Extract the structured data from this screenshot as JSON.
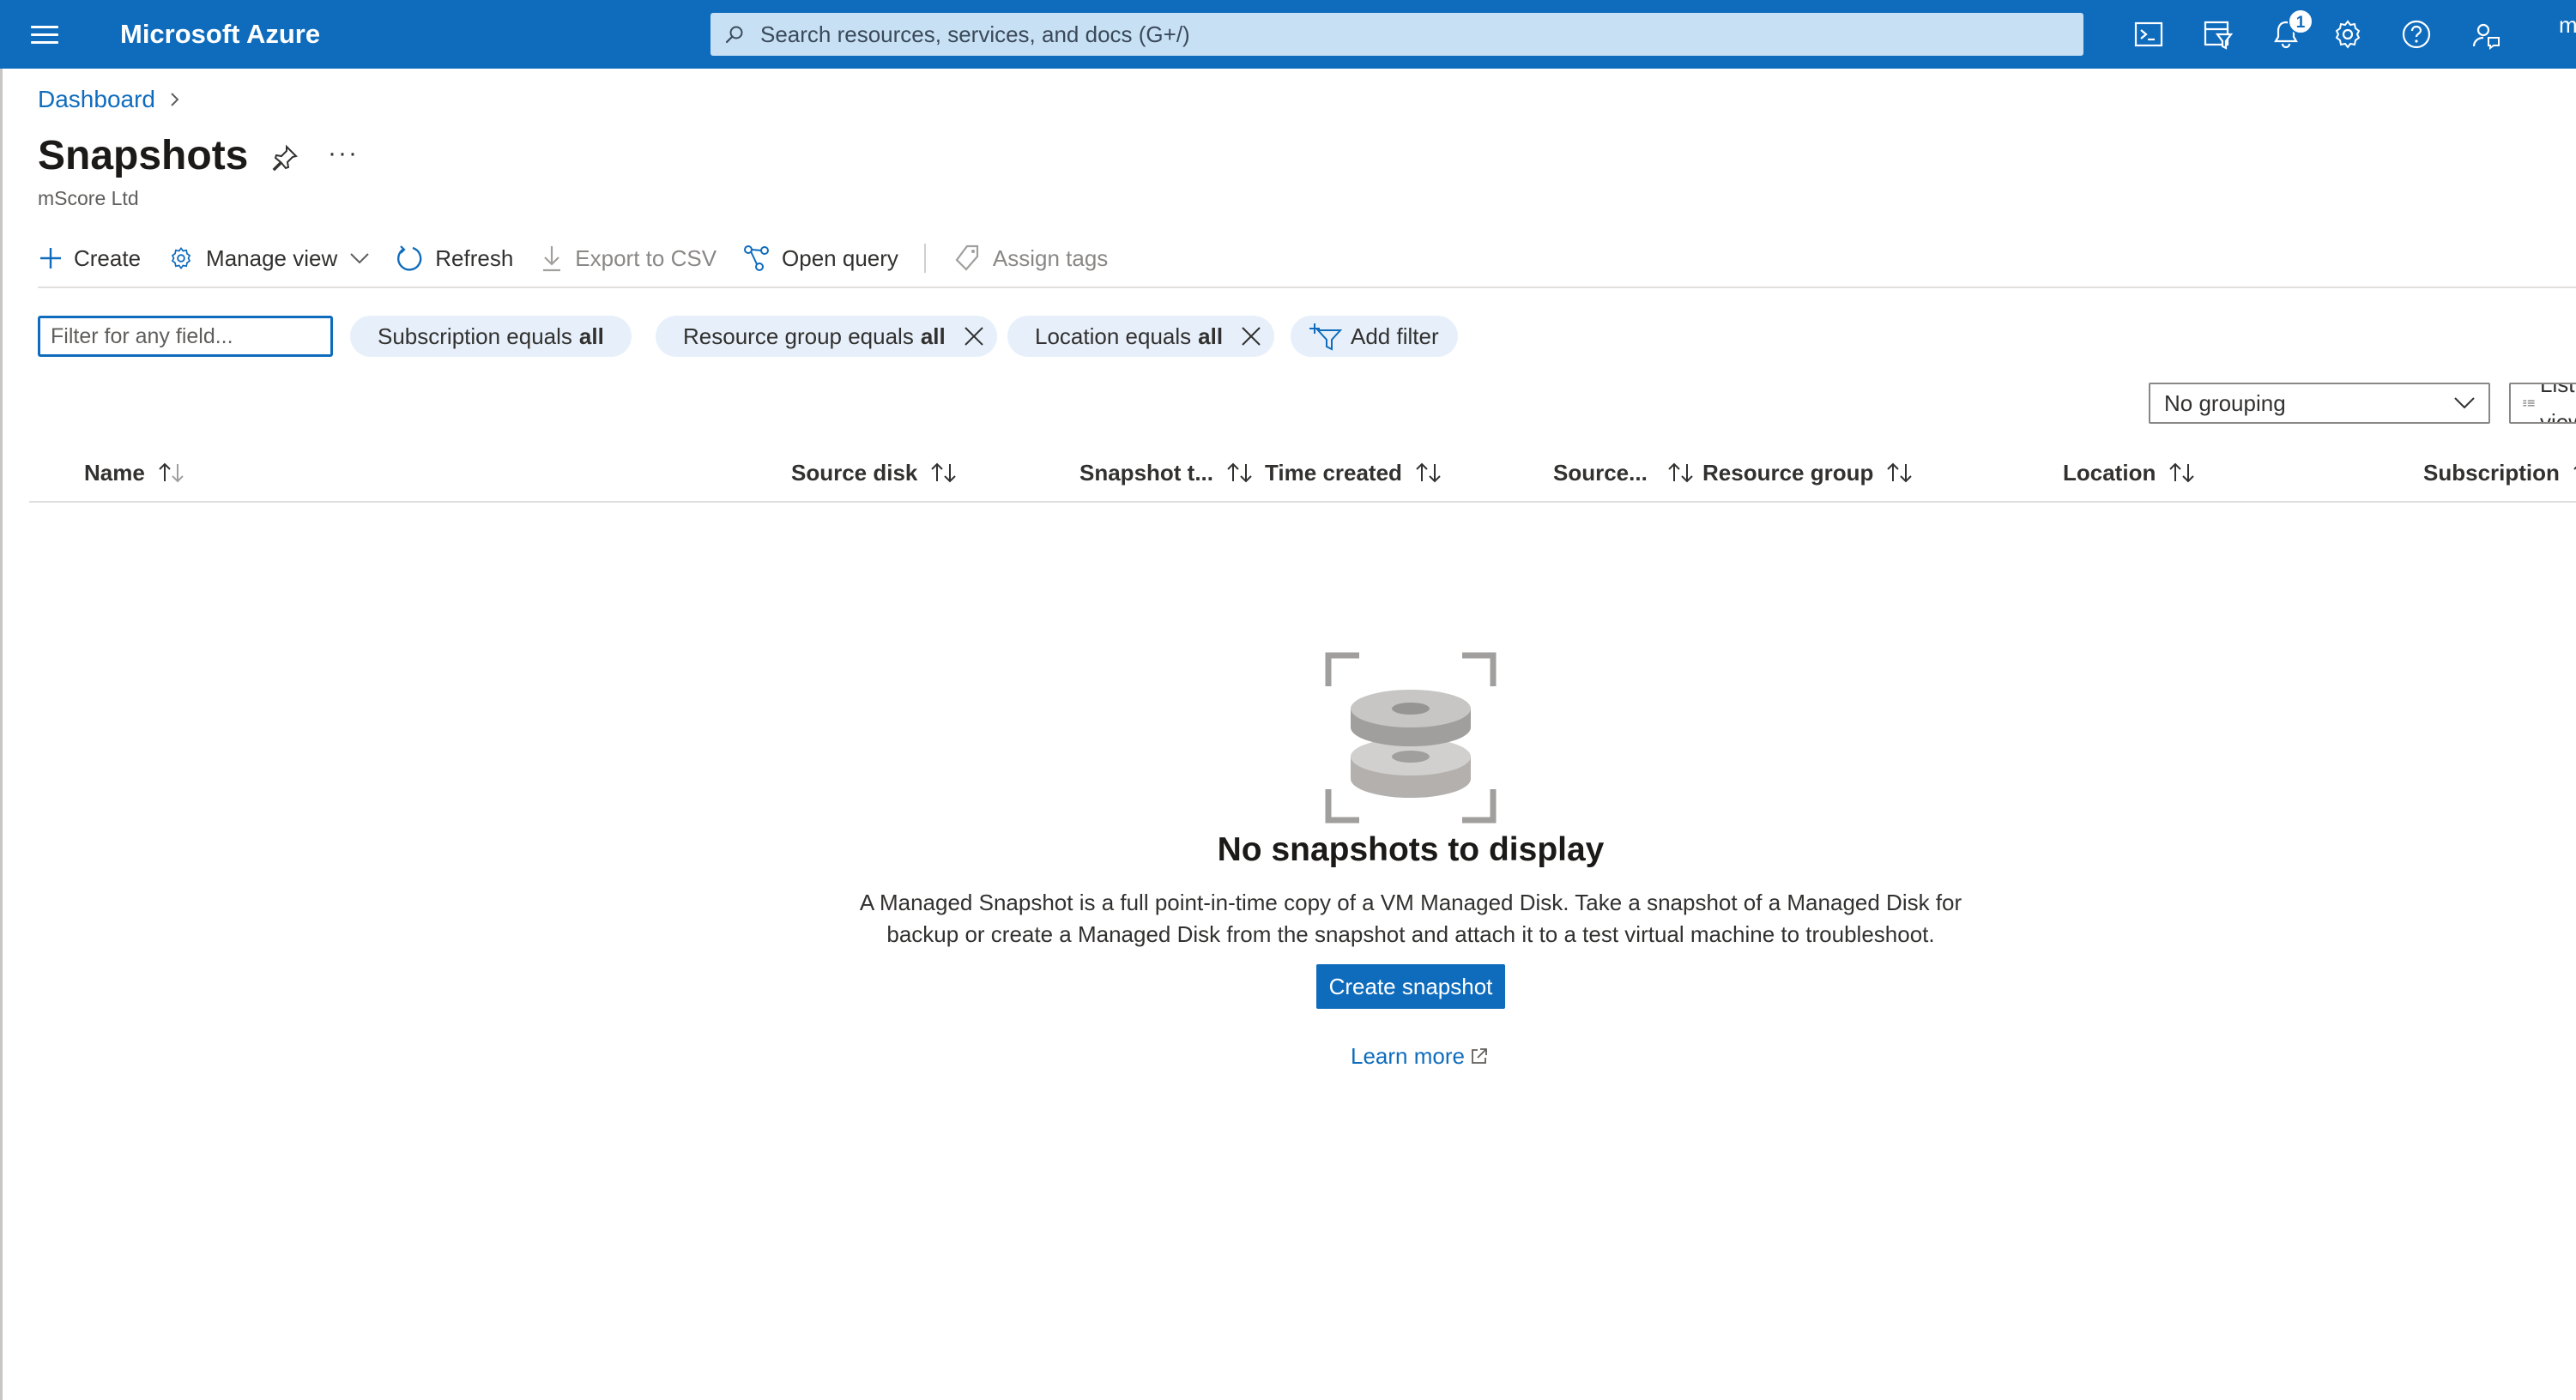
{
  "topbar": {
    "brand": "Microsoft Azure",
    "search_placeholder": "Search resources, services, and docs (G+/)",
    "notification_count": "1",
    "account_initial": "m"
  },
  "breadcrumb": {
    "dashboard": "Dashboard"
  },
  "page": {
    "title": "Snapshots",
    "subtitle": "mScore Ltd",
    "more": "···"
  },
  "commands": {
    "create": "Create",
    "manage_view": "Manage view",
    "refresh": "Refresh",
    "export_csv": "Export to CSV",
    "open_query": "Open query",
    "assign_tags": "Assign tags"
  },
  "filters": {
    "input_placeholder": "Filter for any field...",
    "subscription": {
      "label": "Subscription equals",
      "value": "all"
    },
    "resource_group": {
      "label": "Resource group equals",
      "value": "all"
    },
    "location": {
      "label": "Location equals",
      "value": "all"
    },
    "add_filter": "Add filter"
  },
  "grouping": {
    "selected": "No grouping",
    "view": "List view"
  },
  "columns": {
    "name": "Name",
    "source_disk": "Source disk",
    "snapshot_type": "Snapshot t...",
    "time_created": "Time created",
    "source": "Source...",
    "resource_group": "Resource group",
    "location": "Location",
    "subscription": "Subscription"
  },
  "empty_state": {
    "title": "No snapshots to display",
    "description": "A Managed Snapshot is a full point-in-time copy of a VM Managed Disk. Take a snapshot of a Managed Disk for backup or create a Managed Disk from the snapshot and attach it to a test virtual machine to troubleshoot.",
    "create_button": "Create snapshot",
    "learn_more": "Learn more"
  },
  "colors": {
    "accent": "#0f6cbd",
    "search_bg": "#c7e0f4",
    "pill_bg": "#e7f0fa"
  },
  "icons": {
    "menu": "hamburger-icon",
    "search": "search-icon",
    "cloud_shell": "cloud-shell-icon",
    "directory": "directory-filter-icon",
    "notifications": "bell-icon",
    "settings": "gear-icon",
    "help": "help-icon",
    "feedback": "feedback-icon"
  }
}
